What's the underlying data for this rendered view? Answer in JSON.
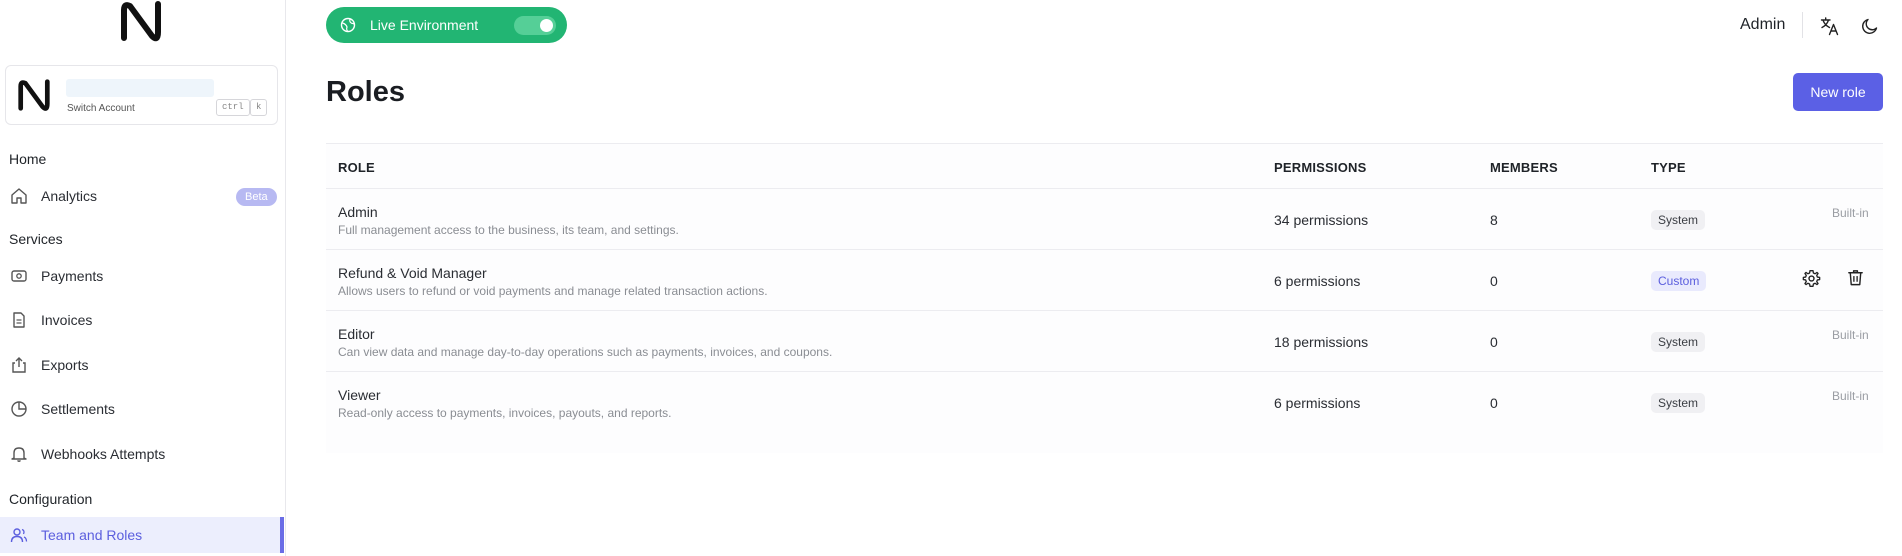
{
  "sidebar": {
    "account": {
      "switch_label": "Switch Account",
      "shortcut_ctrl": "ctrl",
      "shortcut_key": "k"
    },
    "sections": {
      "home": "Home",
      "services": "Services",
      "configuration": "Configuration"
    },
    "items": [
      {
        "label": "Analytics",
        "icon": "home-icon",
        "badge": "Beta"
      },
      {
        "label": "Payments",
        "icon": "payments-icon"
      },
      {
        "label": "Invoices",
        "icon": "invoice-icon"
      },
      {
        "label": "Exports",
        "icon": "export-icon"
      },
      {
        "label": "Settlements",
        "icon": "pie-chart-icon"
      },
      {
        "label": "Webhooks Attempts",
        "icon": "bell-icon"
      },
      {
        "label": "Team and Roles",
        "icon": "users-icon",
        "active": true
      }
    ]
  },
  "topbar": {
    "environment_label": "Live Environment",
    "environment_on": true,
    "user_name": "Admin"
  },
  "main": {
    "title": "Roles",
    "new_role_label": "New role",
    "columns": [
      "ROLE",
      "PERMISSIONS",
      "MEMBERS",
      "TYPE"
    ],
    "rows": [
      {
        "name": "Admin",
        "description": "Full management access to the business, its team, and settings.",
        "permissions": "34 permissions",
        "members": "8",
        "type": "System",
        "note": "Built-in"
      },
      {
        "name": "Refund & Void Manager",
        "description": "Allows users to refund or void payments and manage related transaction actions.",
        "permissions": "6 permissions",
        "members": "0",
        "type": "Custom"
      },
      {
        "name": "Editor",
        "description": "Can view data and manage day-to-day operations such as payments, invoices, and coupons.",
        "permissions": "18 permissions",
        "members": "0",
        "type": "System",
        "note": "Built-in"
      },
      {
        "name": "Viewer",
        "description": "Read-only access to payments, invoices, payouts, and reports.",
        "permissions": "6 permissions",
        "members": "0",
        "type": "System",
        "note": "Built-in"
      }
    ]
  },
  "colors": {
    "accent": "#5b60e5",
    "live_green": "#22b573",
    "custom_badge": "#5b5ede"
  }
}
